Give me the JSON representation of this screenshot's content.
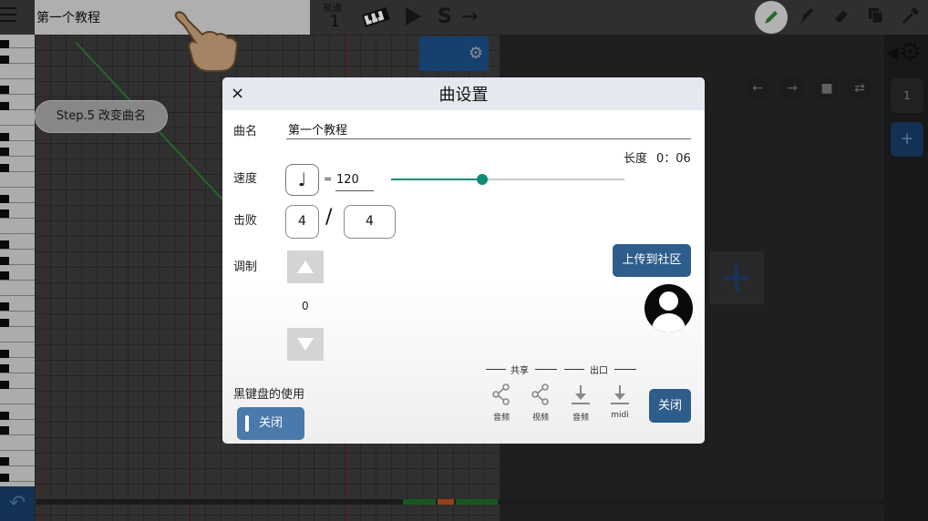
{
  "app": {
    "title": "第一个教程",
    "track_label": "轨道",
    "track_number": "1",
    "step_hint": "Step.5 改变曲名",
    "side_number": "1",
    "side_add": "+"
  },
  "toolbar": {
    "icons": [
      "menu-icon",
      "piano-icon",
      "play-icon",
      "s-icon",
      "arrow-right-icon",
      "pencil-icon",
      "pen-icon",
      "eraser-icon",
      "copy-icon",
      "tools-icon",
      "gear-icon"
    ]
  },
  "dialog": {
    "title": "曲设置",
    "close_glyph": "×",
    "name_label": "曲名",
    "name_value": "第一个教程",
    "length_label": "长度",
    "length_value": "0：06",
    "tempo_label": "速度",
    "tempo_note_glyph": "♩",
    "tempo_equals": "=",
    "tempo_value": "120",
    "tempo_slider_fraction": 0.39,
    "time_sig_label": "击败",
    "time_sig_numerator": "4",
    "time_sig_slash": "/",
    "time_sig_denominator": "4",
    "transpose_label": "调制",
    "transpose_value": "0",
    "upload_label": "上传到社区",
    "black_keys_label": "黑键盘的使用",
    "black_keys_toggle": "关闭",
    "share_header": "共享",
    "export_header": "出口",
    "share_audio": "音频",
    "share_video": "视频",
    "export_audio": "音频",
    "export_midi": "midi",
    "close_button": "关闭"
  },
  "colors": {
    "accent_teal": "#0f8c78",
    "button_blue": "#2e5d8c",
    "toggle_blue": "#4a7aab",
    "pencil_green": "#2e7d32"
  }
}
